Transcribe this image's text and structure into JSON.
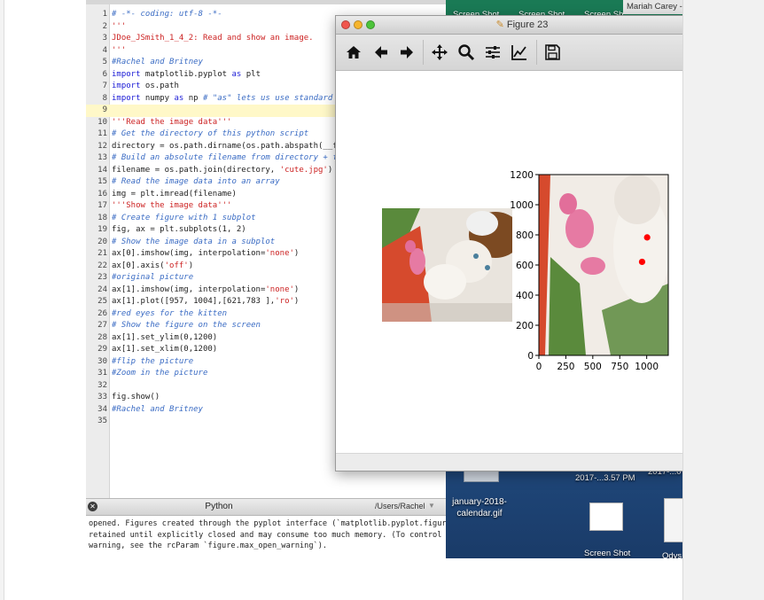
{
  "editor": {
    "lines": [
      {
        "num": "1",
        "parts": [
          {
            "t": "# -*- coding: utf-8 -*-",
            "c": "com"
          }
        ]
      },
      {
        "num": "2",
        "parts": [
          {
            "t": "'''",
            "c": "str"
          }
        ]
      },
      {
        "num": "3",
        "parts": [
          {
            "t": "JDoe_JSmith_1_4_2: Read and show an image.",
            "c": "str"
          }
        ]
      },
      {
        "num": "4",
        "parts": [
          {
            "t": "'''",
            "c": "str"
          }
        ]
      },
      {
        "num": "5",
        "parts": [
          {
            "t": "#Rachel and Britney",
            "c": "com"
          }
        ]
      },
      {
        "num": "6",
        "parts": [
          {
            "t": "import",
            "c": "kw"
          },
          {
            "t": " matplotlib.pyplot ",
            "c": ""
          },
          {
            "t": "as",
            "c": "kw"
          },
          {
            "t": " plt",
            "c": ""
          }
        ]
      },
      {
        "num": "7",
        "parts": [
          {
            "t": "import",
            "c": "kw"
          },
          {
            "t": " os.path",
            "c": ""
          }
        ]
      },
      {
        "num": "8",
        "parts": [
          {
            "t": "import",
            "c": "kw"
          },
          {
            "t": " numpy ",
            "c": ""
          },
          {
            "t": "as",
            "c": "kw"
          },
          {
            "t": " np ",
            "c": ""
          },
          {
            "t": "# \"as\" lets us use standard abbrevia",
            "c": "com"
          }
        ]
      },
      {
        "num": "9",
        "parts": [
          {
            "t": "",
            "c": ""
          }
        ],
        "current": true
      },
      {
        "num": "10",
        "parts": [
          {
            "t": "'''Read the image data'''",
            "c": "str"
          }
        ]
      },
      {
        "num": "11",
        "parts": [
          {
            "t": "# Get the directory of this python script",
            "c": "com"
          }
        ]
      },
      {
        "num": "12",
        "parts": [
          {
            "t": "directory = os.path.dirname(os.path.abspath(__file__))",
            "c": ""
          }
        ]
      },
      {
        "num": "13",
        "parts": [
          {
            "t": "# Build an absolute filename from directory + filename",
            "c": "com"
          }
        ]
      },
      {
        "num": "14",
        "parts": [
          {
            "t": "filename = os.path.join(directory, ",
            "c": ""
          },
          {
            "t": "'cute.jpg'",
            "c": "str"
          },
          {
            "t": ")",
            "c": ""
          }
        ]
      },
      {
        "num": "15",
        "parts": [
          {
            "t": "# Read the image data into an array",
            "c": "com"
          }
        ]
      },
      {
        "num": "16",
        "parts": [
          {
            "t": "img = plt.imread(filename)",
            "c": ""
          }
        ]
      },
      {
        "num": "17",
        "parts": [
          {
            "t": "'''Show the image data'''",
            "c": "str"
          }
        ]
      },
      {
        "num": "18",
        "parts": [
          {
            "t": "# Create figure with 1 subplot",
            "c": "com"
          }
        ]
      },
      {
        "num": "19",
        "parts": [
          {
            "t": "fig, ax = plt.subplots(1, 2)",
            "c": ""
          }
        ]
      },
      {
        "num": "20",
        "parts": [
          {
            "t": "# Show the image data in a subplot",
            "c": "com"
          }
        ]
      },
      {
        "num": "21",
        "parts": [
          {
            "t": "ax[0].imshow(img, interpolation=",
            "c": ""
          },
          {
            "t": "'none'",
            "c": "str"
          },
          {
            "t": ")",
            "c": ""
          }
        ]
      },
      {
        "num": "22",
        "parts": [
          {
            "t": "ax[0].axis(",
            "c": ""
          },
          {
            "t": "'off'",
            "c": "str"
          },
          {
            "t": ")",
            "c": ""
          }
        ]
      },
      {
        "num": "23",
        "parts": [
          {
            "t": "#original picture",
            "c": "com"
          }
        ]
      },
      {
        "num": "24",
        "parts": [
          {
            "t": "ax[1].imshow(img, interpolation=",
            "c": ""
          },
          {
            "t": "'none'",
            "c": "str"
          },
          {
            "t": ")",
            "c": ""
          }
        ]
      },
      {
        "num": "25",
        "parts": [
          {
            "t": "ax[1].plot([957, 1004],[621,783 ],",
            "c": ""
          },
          {
            "t": "'ro'",
            "c": "str"
          },
          {
            "t": ")",
            "c": ""
          }
        ]
      },
      {
        "num": "26",
        "parts": [
          {
            "t": "#red eyes for the kitten",
            "c": "com"
          }
        ]
      },
      {
        "num": "27",
        "parts": [
          {
            "t": "# Show the figure on the screen",
            "c": "com"
          }
        ]
      },
      {
        "num": "28",
        "parts": [
          {
            "t": "ax[1].set_ylim(0,1200)",
            "c": ""
          }
        ]
      },
      {
        "num": "29",
        "parts": [
          {
            "t": "ax[1].set_xlim(0,1200)",
            "c": ""
          }
        ]
      },
      {
        "num": "30",
        "parts": [
          {
            "t": "#flip the picture",
            "c": "com"
          }
        ]
      },
      {
        "num": "31",
        "parts": [
          {
            "t": "#Zoom in the picture",
            "c": "com"
          }
        ]
      },
      {
        "num": "32",
        "parts": [
          {
            "t": "",
            "c": ""
          }
        ]
      },
      {
        "num": "33",
        "parts": [
          {
            "t": "fig.show()",
            "c": ""
          }
        ]
      },
      {
        "num": "34",
        "parts": [
          {
            "t": "#Rachel and Britney",
            "c": "com"
          }
        ]
      },
      {
        "num": "35",
        "parts": [
          {
            "t": "",
            "c": ""
          }
        ]
      }
    ]
  },
  "console": {
    "title": "Python",
    "path": "/Users/Rachel",
    "lines": [
      "opened. Figures created through the pyplot interface (`matplotlib.pyplot.figure`) are",
      "retained until explicitly closed and may consume too much memory. (To control this",
      "warning, see the rcParam `figure.max_open_warning`)."
    ]
  },
  "desktop": {
    "top_labels": [
      "Screen Shot",
      "Screen Shot",
      "Screen Sh"
    ],
    "mariah": "Mariah Carey -",
    "calendar_label": "january-2018-\ncalendar.gif",
    "time_label": "2017-...3.57 PM",
    "time_label2": "2017-...0",
    "bottom_label": "Screen Shot",
    "bottom_label2": "Odys"
  },
  "figure": {
    "window_title": "Figure 23",
    "toolbar": [
      {
        "name": "home-icon",
        "interactable": true
      },
      {
        "name": "back-arrow-icon",
        "interactable": true
      },
      {
        "name": "forward-arrow-icon",
        "interactable": true
      },
      {
        "name": "pan-icon",
        "interactable": true
      },
      {
        "name": "zoom-icon",
        "interactable": true
      },
      {
        "name": "subplots-config-icon",
        "interactable": true
      },
      {
        "name": "edit-axis-icon",
        "interactable": true
      },
      {
        "name": "save-icon",
        "interactable": true
      }
    ]
  },
  "chart_data": {
    "type": "scatter",
    "title": "",
    "xlabel": "",
    "ylabel": "",
    "xlim": [
      0,
      1200
    ],
    "ylim": [
      0,
      1200
    ],
    "xticks": [
      0,
      250,
      500,
      750,
      1000
    ],
    "yticks": [
      0,
      200,
      400,
      600,
      800,
      1000,
      1200
    ],
    "series": [
      {
        "x": [
          957,
          1004
        ],
        "y": [
          621,
          783
        ],
        "color": "#ff0000",
        "marker": "o"
      }
    ]
  },
  "colors": {
    "comment": "#3b6cc4",
    "string": "#cc2222",
    "keyword": "#1b1bd6",
    "highlight": "#fff8c8",
    "marker": "#ff0000"
  }
}
